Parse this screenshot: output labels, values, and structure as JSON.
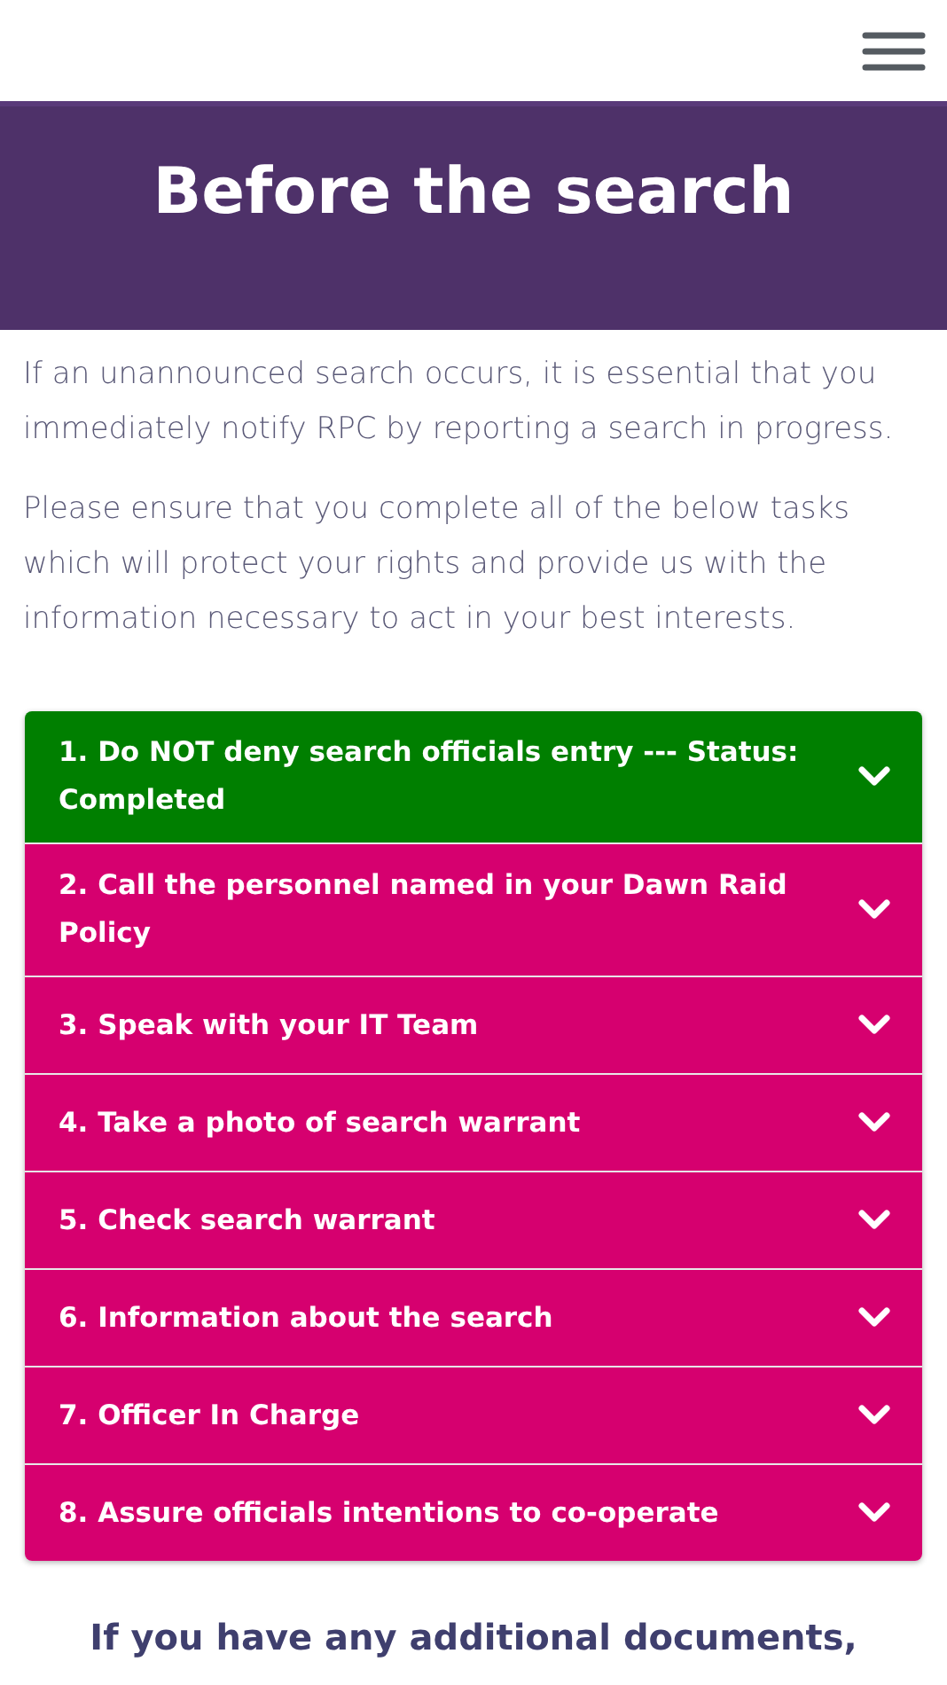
{
  "banner": {
    "title": "Before the search"
  },
  "intro": [
    "If an unannounced search occurs, it is essential that you immediately notify RPC by reporting a search in progress.",
    "Please ensure that you complete all of the below tasks which will protect your rights and provide us with the information necessary to act in your best interests."
  ],
  "tasks": [
    {
      "label": "1. Do NOT deny search officials entry --- Status: Completed",
      "completed": true
    },
    {
      "label": "2. Call the personnel named in your Dawn Raid Policy",
      "completed": false
    },
    {
      "label": "3. Speak with your IT Team",
      "completed": false
    },
    {
      "label": "4. Take a photo of search warrant",
      "completed": false
    },
    {
      "label": "5. Check search warrant",
      "completed": false
    },
    {
      "label": "6. Information about the search",
      "completed": false
    },
    {
      "label": "7. Officer In Charge",
      "completed": false
    },
    {
      "label": "8. Assure officials intentions to co-operate",
      "completed": false
    }
  ],
  "footer_note": "If you have any additional documents,"
}
